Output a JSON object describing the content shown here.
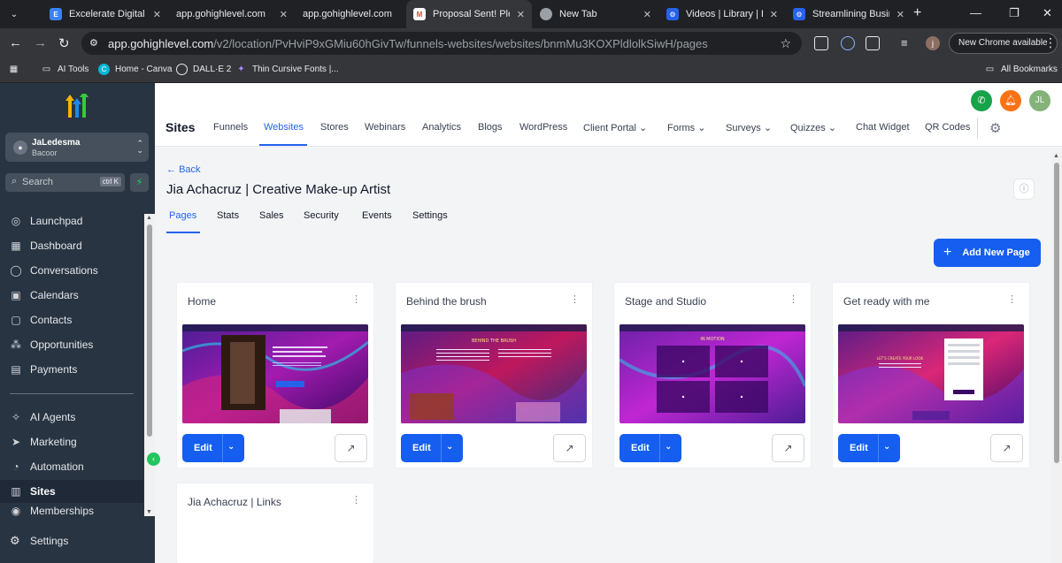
{
  "browser": {
    "tabs": [
      {
        "title": "Excelerate Digital Ma",
        "favicon": "E",
        "favicon_color": "#3b82f6"
      },
      {
        "title": "app.gohighlevel.com",
        "favicon": "",
        "favicon_color": "#202124"
      },
      {
        "title": "app.gohighlevel.com",
        "favicon": "",
        "favicon_color": "#202124"
      },
      {
        "title": "Proposal Sent! Pleas",
        "favicon": "M",
        "favicon_color": "#ea4335"
      },
      {
        "title": "New Tab",
        "favicon": "",
        "favicon_color": "#9aa0a6"
      },
      {
        "title": "Videos | Library | Loo",
        "favicon": "⚙",
        "favicon_color": "#2563eb"
      },
      {
        "title": "Streamlining Busines",
        "favicon": "⚙",
        "favicon_color": "#2563eb"
      }
    ],
    "url_domain": "app.gohighlevel.com",
    "url_path": "/v2/location/PvHviP9xGMiu60hGivTw/funnels-websites/websites/bnmMu3KOXPldlolkSiwH/pages",
    "chrome_button": "New Chrome available",
    "profile_initial": "j",
    "bookmarks": [
      "AI Tools",
      "Home - Canva",
      "DALL·E 2",
      "Thin Cursive Fonts |..."
    ],
    "all_bookmarks": "All Bookmarks"
  },
  "sidebar": {
    "location_name": "JaLedesma",
    "location_sub": "Bacoor",
    "search_placeholder": "Search",
    "search_shortcut": "ctrl K",
    "items": [
      {
        "label": "Launchpad",
        "icon": "launchpad-icon"
      },
      {
        "label": "Dashboard",
        "icon": "dashboard-icon"
      },
      {
        "label": "Conversations",
        "icon": "conversations-icon"
      },
      {
        "label": "Calendars",
        "icon": "calendar-icon"
      },
      {
        "label": "Contacts",
        "icon": "contacts-icon"
      },
      {
        "label": "Opportunities",
        "icon": "opportunities-icon"
      },
      {
        "label": "Payments",
        "icon": "payments-icon"
      },
      {
        "label": "AI Agents",
        "icon": "ai-agents-icon"
      },
      {
        "label": "Marketing",
        "icon": "marketing-icon"
      },
      {
        "label": "Automation",
        "icon": "automation-icon"
      },
      {
        "label": "Sites",
        "icon": "sites-icon"
      },
      {
        "label": "Memberships",
        "icon": "memberships-icon"
      }
    ],
    "settings_label": "Settings"
  },
  "header": {
    "avatar_initials": "JL",
    "title": "Sites",
    "nav": [
      "Funnels",
      "Websites",
      "Stores",
      "Webinars",
      "Analytics",
      "Blogs",
      "WordPress",
      "Client Portal",
      "Forms",
      "Surveys",
      "Quizzes",
      "Chat Widget",
      "QR Codes"
    ],
    "active_nav": "Websites"
  },
  "page": {
    "back_label": "Back",
    "title": "Jia Achacruz | Creative Make-up Artist",
    "tabs": [
      "Pages",
      "Stats",
      "Sales",
      "Security",
      "Events",
      "Settings"
    ],
    "active_tab": "Pages",
    "add_button": "Add New Page",
    "edit_label": "Edit",
    "cards": [
      {
        "title": "Home",
        "thumb_heading": ""
      },
      {
        "title": "Behind the brush",
        "thumb_heading": "BEHIND THE BRUSH"
      },
      {
        "title": "Stage and Studio",
        "thumb_heading": "IN MOTION"
      },
      {
        "title": "Get ready with me",
        "thumb_heading": "LET'S CREATE YOUR LOOK"
      },
      {
        "title": "Jia Achacruz | Links",
        "thumb_heading": ""
      }
    ]
  },
  "colors": {
    "accent": "#155eef",
    "sidebar_bg": "#283441",
    "phone_green": "#16a34a",
    "bell_orange": "#f97316",
    "avatar_green": "#84b37a"
  }
}
